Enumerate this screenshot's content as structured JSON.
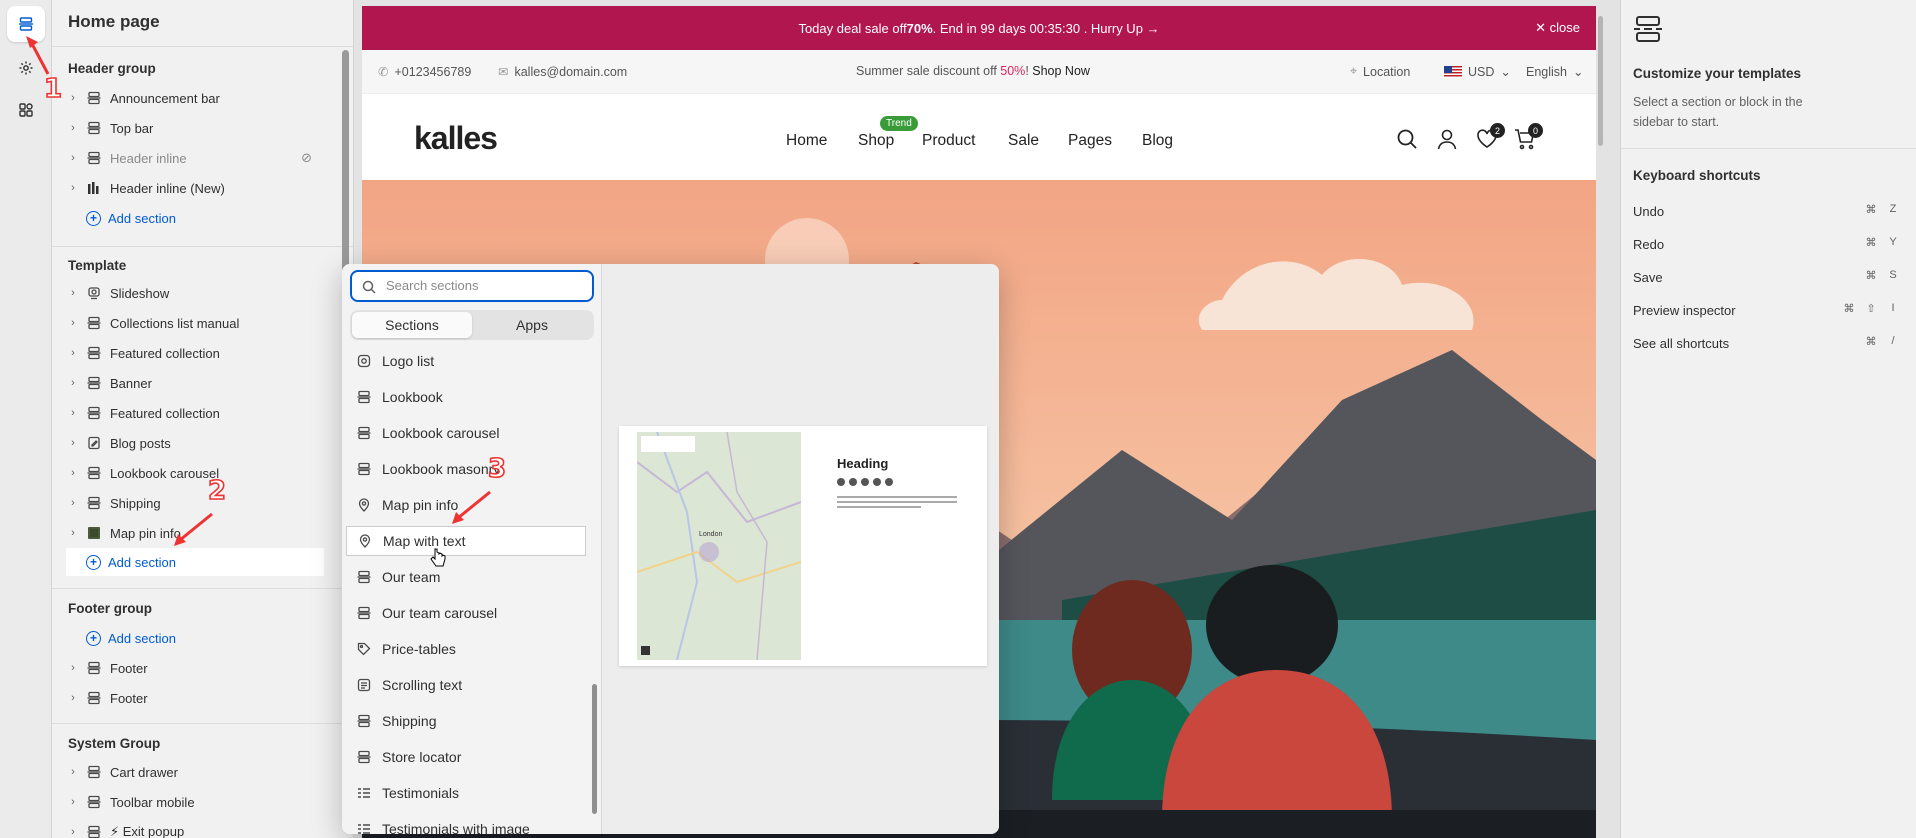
{
  "sidebar": {
    "title": "Home page",
    "header_group": {
      "heading": "Header group",
      "items": [
        {
          "label": "Announcement bar",
          "icon": "section-icon"
        },
        {
          "label": "Top bar",
          "icon": "section-icon"
        },
        {
          "label": "Header inline",
          "icon": "section-icon",
          "hidden": true
        },
        {
          "label": "Header inline (New)",
          "icon": "bar-chart-icon"
        }
      ],
      "add_label": "Add section"
    },
    "template": {
      "heading": "Template",
      "items": [
        {
          "label": "Slideshow",
          "icon": "slideshow-icon"
        },
        {
          "label": "Collections list manual",
          "icon": "section-icon"
        },
        {
          "label": "Featured collection",
          "icon": "section-icon"
        },
        {
          "label": "Banner",
          "icon": "section-icon"
        },
        {
          "label": "Featured collection",
          "icon": "section-icon"
        },
        {
          "label": "Blog posts",
          "icon": "blog-icon"
        },
        {
          "label": "Lookbook carousel",
          "icon": "section-icon"
        },
        {
          "label": "Shipping",
          "icon": "section-icon"
        },
        {
          "label": "Map pin info",
          "icon": "image-thumb-icon"
        }
      ],
      "add_label": "Add section"
    },
    "footer_group": {
      "heading": "Footer group",
      "add_label": "Add section",
      "items": [
        {
          "label": "Footer",
          "icon": "section-icon"
        },
        {
          "label": "Footer",
          "icon": "section-icon"
        }
      ]
    },
    "system_group": {
      "heading": "System Group",
      "items": [
        {
          "label": "Cart drawer",
          "icon": "section-icon"
        },
        {
          "label": "Toolbar mobile",
          "icon": "section-icon"
        },
        {
          "label": "⚡ Exit popup",
          "icon": "section-icon"
        }
      ]
    }
  },
  "preview": {
    "announcement": {
      "pre": "Today deal sale off ",
      "bold": "70%",
      "post": ". End in 99 days 00:35:30 .  Hurry Up →",
      "close": "close"
    },
    "topbar": {
      "phone": "+0123456789",
      "email": "kalles@domain.com",
      "promo_pre": "Summer sale discount off ",
      "promo_pct": "50%",
      "promo_post": "! ",
      "promo_link": "Shop Now",
      "location": "Location",
      "currency": "USD",
      "language": "English"
    },
    "header": {
      "logo": "kalles",
      "nav": [
        "Home",
        "Shop",
        "Product",
        "Sale",
        "Pages",
        "Blog"
      ],
      "trend_badge": "Trend",
      "wishlist_count": "2",
      "cart_count": "0"
    }
  },
  "picker": {
    "search_placeholder": "Search sections",
    "tabs": [
      "Sections",
      "Apps"
    ],
    "items": [
      {
        "label": "Logo list",
        "icon": "logo-list-icon"
      },
      {
        "label": "Lookbook",
        "icon": "section-icon"
      },
      {
        "label": "Lookbook carousel",
        "icon": "section-icon"
      },
      {
        "label": "Lookbook masonry",
        "icon": "section-icon"
      },
      {
        "label": "Map pin info",
        "icon": "map-pin-icon"
      },
      {
        "label": "Map with text",
        "icon": "map-pin-icon"
      },
      {
        "label": "Our team",
        "icon": "section-icon"
      },
      {
        "label": "Our team carousel",
        "icon": "section-icon"
      },
      {
        "label": "Price-tables",
        "icon": "price-tag-icon"
      },
      {
        "label": "Scrolling text",
        "icon": "text-icon"
      },
      {
        "label": "Shipping",
        "icon": "section-icon"
      },
      {
        "label": "Store locator",
        "icon": "section-icon"
      },
      {
        "label": "Testimonials",
        "icon": "list-icon"
      },
      {
        "label": "Testimonials with image",
        "icon": "list-icon"
      }
    ],
    "preview_heading": "Heading",
    "map_label": "London"
  },
  "right_panel": {
    "title": "Customize your templates",
    "description": "Select a section or block in the sidebar to start.",
    "shortcuts_heading": "Keyboard shortcuts",
    "shortcuts": [
      {
        "label": "Undo",
        "keys": [
          "⌘",
          "Z"
        ]
      },
      {
        "label": "Redo",
        "keys": [
          "⌘",
          "Y"
        ]
      },
      {
        "label": "Save",
        "keys": [
          "⌘",
          "S"
        ]
      },
      {
        "label": "Preview inspector",
        "keys": [
          "⌘",
          "⇧",
          "I"
        ]
      },
      {
        "label": "See all shortcuts",
        "keys": [
          "⌘",
          "/"
        ]
      }
    ]
  },
  "annotations": [
    "1",
    "2",
    "3"
  ],
  "colors": {
    "accent": "#005bd3",
    "announcement_bg": "#b1164f",
    "marker": "#e33333",
    "trend": "#3a9c39"
  }
}
